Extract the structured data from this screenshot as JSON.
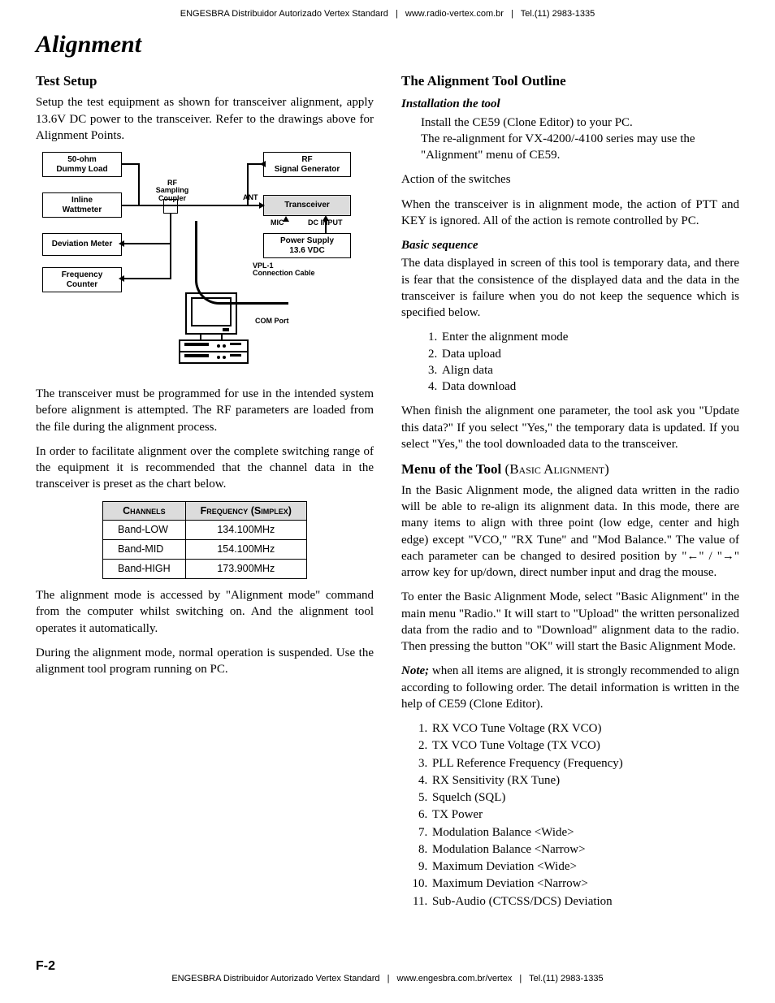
{
  "header": {
    "distributor": "ENGESBRA Distribuidor Autorizado Vertex Standard",
    "url": "www.radio-vertex.com.br",
    "tel": "Tel.(11) 2983-1335"
  },
  "footer": {
    "distributor": "ENGESBRA Distribuidor Autorizado Vertex Standard",
    "url": "www.engesbra.com.br/vertex",
    "tel": "Tel.(11) 2983-1335"
  },
  "page_number": "F-2",
  "title": "Alignment",
  "left": {
    "test_setup_h": "Test Setup",
    "test_setup_p1": "Setup the test equipment as shown for transceiver alignment, apply 13.6V DC power to the transceiver. Refer to the drawings above for Alignment Points.",
    "test_setup_p2": "The transceiver must be programmed for use in the intended system before alignment is attempted. The RF parameters are loaded from the file during the alignment process.",
    "test_setup_p3": "In order to facilitate alignment over the complete switching range of the equipment it is recommended that the channel data in the transceiver is preset as the chart below.",
    "table": {
      "h1": "Channels",
      "h2": "Frequency (Simplex)",
      "rows": [
        {
          "ch": "Band-LOW",
          "fr": "134.100MHz"
        },
        {
          "ch": "Band-MID",
          "fr": "154.100MHz"
        },
        {
          "ch": "Band-HIGH",
          "fr": "173.900MHz"
        }
      ]
    },
    "test_setup_p4": "The alignment mode is accessed by \"Alignment mode\" command from the computer whilst switching on. And the alignment tool operates it automatically.",
    "test_setup_p5": "During the alignment mode, normal operation is suspended. Use the alignment tool program running on PC."
  },
  "right": {
    "outline_h": "The Alignment Tool Outline",
    "install_sub": "Installation the tool",
    "install_l1": "Install the CE59 (Clone Editor) to your PC.",
    "install_l2": "The re-alignment for VX-4200/-4100 series may use the \"Alignment\" menu of CE59.",
    "action_h": "Action of the switches",
    "action_p": "When the transceiver is in alignment mode, the action of PTT and KEY is ignored. All of the action is remote controlled by PC.",
    "basic_sub": "Basic sequence",
    "basic_p1": "The data displayed in screen of this tool is temporary data, and there is fear that the consistence of the displayed data and the data in the transceiver is failure when you do not keep the sequence which is specified below.",
    "seq": [
      "Enter the alignment mode",
      "Data upload",
      "Align data",
      "Data download"
    ],
    "basic_p2": "When finish the alignment one parameter, the tool ask you \"Update this data?\" If you select \"Yes,\" the temporary data is updated. If you select \"Yes,\" the tool downloaded data to the transceiver.",
    "menu_h": "Menu of the Tool",
    "menu_h_paren": "(Basic Alignment)",
    "menu_p1": "In the Basic Alignment mode, the aligned data written in the radio will be able to re-align its alignment data. In this mode, there are many items to align with three point (low edge, center and high edge) except \"VCO,\" \"RX Tune\" and \"Mod Balance.\" The value of each parameter can be changed to desired position by \"←\" / \"→\" arrow key for up/down, direct number input and drag the mouse.",
    "menu_p2": "To enter the Basic Alignment Mode, select \"Basic Alignment\" in the main menu \"Radio.\" It will start to \"Upload\" the written personalized data from the radio and to \"Download\" alignment data to the radio. Then pressing the button \"OK\" will start the Basic Alignment Mode.",
    "note_lead": "Note;",
    "menu_p3": " when all items are aligned, it is strongly recommended to align according to following order. The detail information is written in the help of CE59 (Clone Editor).",
    "items": [
      "RX VCO Tune Voltage (RX VCO)",
      "TX VCO Tune Voltage (TX VCO)",
      "PLL Reference Frequency (Frequency)",
      "RX Sensitivity (RX Tune)",
      "Squelch (SQL)",
      "TX Power",
      "Modulation Balance <Wide>",
      "Modulation Balance <Narrow>",
      "Maximum Deviation <Wide>",
      "Maximum Deviation <Narrow>",
      "Sub-Audio (CTCSS/DCS) Deviation"
    ]
  },
  "diagram": {
    "dummy": "50-ohm\nDummy Load",
    "inline": "Inline\nWattmeter",
    "dev": "Deviation Meter",
    "freqc": "Frequency\nCounter",
    "rf": "RF\nSignal Generator",
    "trx": "Transceiver",
    "psu": "Power Supply\n13.6 VDC",
    "coupler": "RF Sampling\nCoupler",
    "ant": "ANT",
    "mic": "MIC",
    "dcin": "DC INPUT",
    "vpl": "VPL-1\nConnection Cable",
    "com": "COM Port"
  }
}
